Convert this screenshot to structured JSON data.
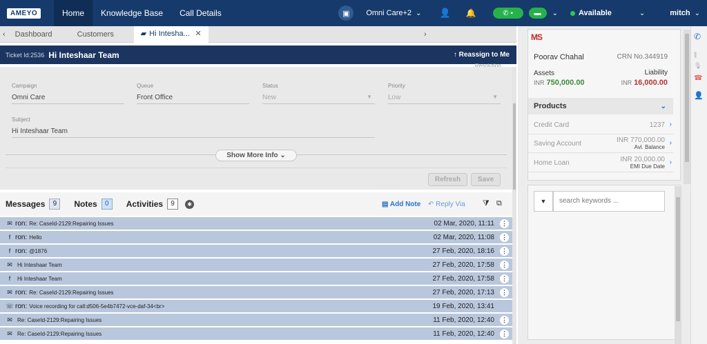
{
  "app": {
    "logo": "AMEYO"
  },
  "topnav": {
    "items": [
      "Home",
      "Knowledge Base",
      "Call Details"
    ],
    "campaign": "Omni Care+2",
    "status": "Available",
    "user": "mitch"
  },
  "tabs": [
    "Dashboard",
    "Customers",
    "Hi Intesha..."
  ],
  "ticket": {
    "id_label": "Ticket Id:2536",
    "title": "Hi Inteshaar Team",
    "reassign": "Reassign to Me",
    "resolution": "Resolution"
  },
  "form": {
    "campaign_label": "Campaign",
    "campaign": "Omni Care",
    "queue_label": "Queue",
    "queue": "Front Office",
    "status_label": "Status",
    "status": "New",
    "priority_label": "Priority",
    "priority": "Low",
    "subject_label": "Subject",
    "subject": "Hi Inteshaar Team",
    "show_more": "Show More Info",
    "refresh": "Refresh",
    "save": "Save"
  },
  "messages_header": {
    "messages_label": "Messages",
    "messages_count": "9",
    "notes_label": "Notes",
    "notes_count": "0",
    "activities_label": "Activities",
    "activities_count": "9",
    "add_note": "Add Note",
    "reply_via": "Reply Via"
  },
  "messages": [
    {
      "icon": "email-icon",
      "from": "ron:",
      "subject": "Re: CaseId-2129:Repairing Issues",
      "date": "02 Mar, 2020, 11:11"
    },
    {
      "icon": "facebook-icon",
      "from": "ron:",
      "subject": "Hello",
      "date": "02 Mar, 2020, 11:08"
    },
    {
      "icon": "facebook-icon",
      "from": "ron:",
      "subject": "@1876",
      "date": "27 Feb, 2020, 18:16"
    },
    {
      "icon": "email-icon",
      "from": "",
      "subject": "Hi Inteshaar Team",
      "date": "27 Feb, 2020, 17:58"
    },
    {
      "icon": "facebook-icon",
      "from": "",
      "subject": "Hi Inteshaar Team",
      "date": "27 Feb, 2020, 17:58"
    },
    {
      "icon": "email-icon",
      "from": "ron:",
      "subject": "Re: CaseId-2129:Repairing Issues",
      "date": "27 Feb, 2020, 17:13"
    },
    {
      "icon": "voice-icon",
      "from": "ron:",
      "subject": "Voice recording for call:d506-5e4b7472-vce-daf-34<br>",
      "date": "19 Feb, 2020, 13:41"
    },
    {
      "icon": "email-icon",
      "from": "",
      "subject": "Re: CaseId-2129:Repairing Issues",
      "date": "11 Feb, 2020, 12:40"
    },
    {
      "icon": "email-icon",
      "from": "",
      "subject": "Re: CaseId-2129:Repairing Issues",
      "date": "11 Feb, 2020, 12:40"
    }
  ],
  "customer": {
    "logo": "MS",
    "name": "Poorav Chahal",
    "crn": "CRN No.344919",
    "assets_label": "Assets",
    "liability_label": "Liability",
    "currency": "INR",
    "assets": "750,000.00",
    "liability": "16,000.00",
    "products_label": "Products",
    "products": [
      {
        "name": "Credit Card",
        "value": "1237",
        "sub": ""
      },
      {
        "name": "Saving Account",
        "value": "INR 770,000.00",
        "sub": "Avl. Balance"
      },
      {
        "name": "Home Loan",
        "value": "INR 20,000.00",
        "sub": "EMI Due Date"
      }
    ]
  },
  "search": {
    "placeholder": "search keywords ..."
  },
  "colors": {
    "topbar": "#163a6b",
    "message_row": "#b9c7dd",
    "accent": "#2a72c9",
    "assets": "#3a8b3a",
    "liability": "#b43333"
  }
}
